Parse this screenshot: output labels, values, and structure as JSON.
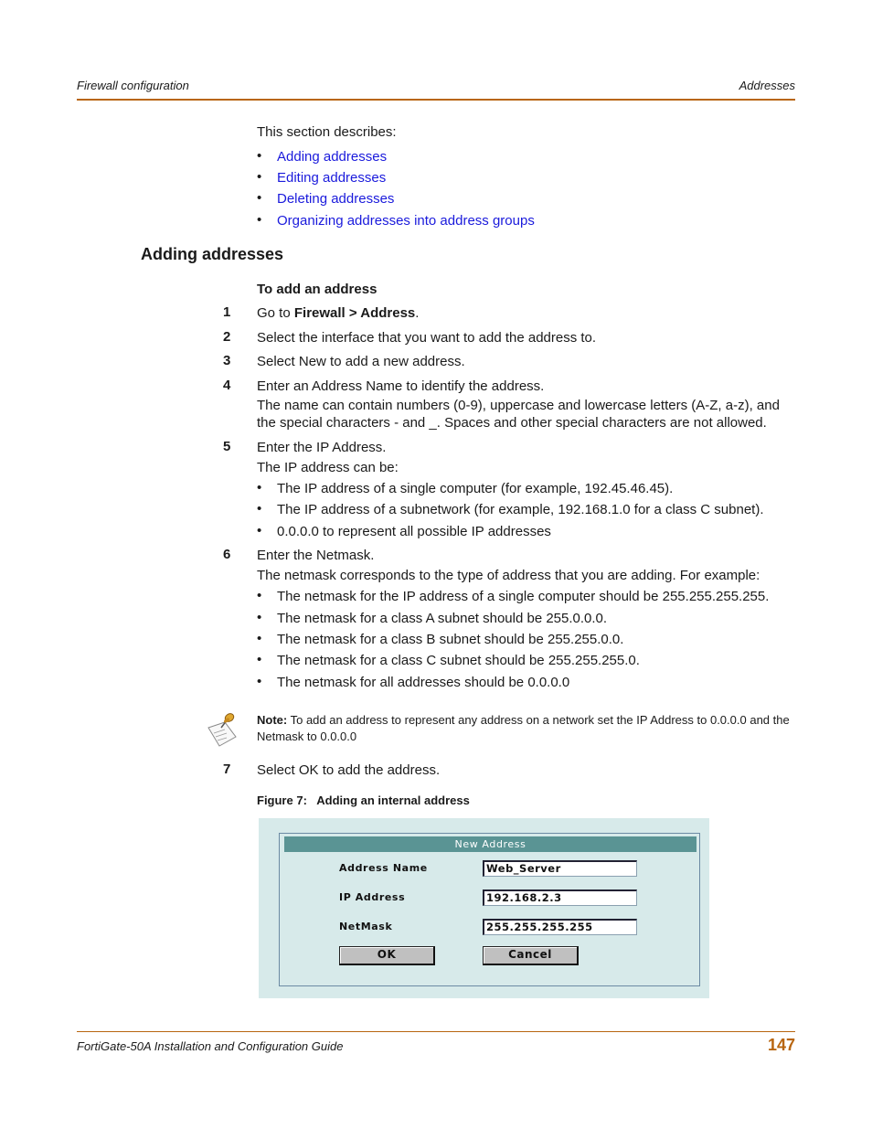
{
  "header": {
    "left": "Firewall configuration",
    "right": "Addresses"
  },
  "intro": {
    "lead": "This section describes:",
    "links": [
      "Adding addresses",
      "Editing addresses",
      "Deleting addresses",
      "Organizing addresses into address groups"
    ]
  },
  "section": {
    "title": "Adding addresses",
    "procedure_title": "To add an address",
    "steps": [
      {
        "num": "1",
        "pre": "Go to ",
        "bold": "Firewall > Address",
        "post": "."
      },
      {
        "num": "2",
        "text": "Select the interface that you want to add the address to."
      },
      {
        "num": "3",
        "text": "Select New to add a new address."
      },
      {
        "num": "4",
        "text": "Enter an Address Name to identify the address.",
        "detail": "The name can contain numbers (0-9), uppercase and lowercase letters (A-Z, a-z), and the special characters - and _. Spaces and other special characters are not allowed."
      },
      {
        "num": "5",
        "text": "Enter the IP Address.",
        "detail": "The IP address can be:",
        "bullets": [
          "The IP address of a single computer (for example, 192.45.46.45).",
          "The IP address of a subnetwork (for example, 192.168.1.0 for a class C subnet).",
          "0.0.0.0 to represent all possible IP addresses"
        ]
      },
      {
        "num": "6",
        "text": "Enter the Netmask.",
        "detail": "The netmask corresponds to the type of address that you are adding. For example:",
        "bullets": [
          "The netmask for the IP address of a single computer should be 255.255.255.255.",
          "The netmask for a class A subnet should be 255.0.0.0.",
          "The netmask for a class B subnet should be 255.255.0.0.",
          "The netmask for a class C subnet should be 255.255.255.0.",
          "The netmask for all addresses should be 0.0.0.0"
        ]
      },
      {
        "num": "7",
        "text": "Select OK to add the address."
      }
    ],
    "note": {
      "label": "Note:",
      "text": " To add an address to represent any address on a network set the IP Address to 0.0.0.0 and the Netmask to 0.0.0.0"
    },
    "figure_caption": "Figure 7:   Adding an internal address"
  },
  "dialog": {
    "title": "New Address",
    "fields": [
      {
        "label": "Address Name",
        "value": "Web_Server"
      },
      {
        "label": "IP Address",
        "value": "192.168.2.3"
      },
      {
        "label": "NetMask",
        "value": "255.255.255.255"
      }
    ],
    "ok_label": "OK",
    "cancel_label": "Cancel"
  },
  "footer": {
    "title": "FortiGate-50A Installation and Configuration Guide",
    "page_number": "147"
  },
  "colors": {
    "accent_rule": "#b8650f",
    "link": "#1a1adc",
    "dialog_title_bg": "#5a9494"
  }
}
